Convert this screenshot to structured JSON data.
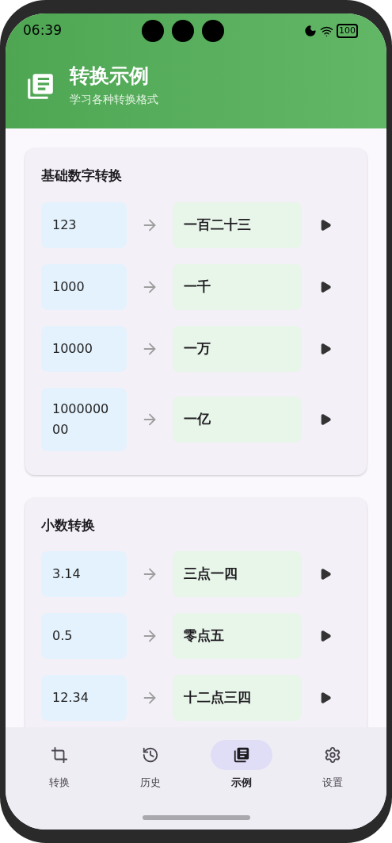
{
  "status_bar": {
    "time": "06:39",
    "battery": "100"
  },
  "header": {
    "title": "转换示例",
    "subtitle": "学习各种转换格式"
  },
  "sections": [
    {
      "title": "基础数字转换",
      "examples": [
        {
          "input": "123",
          "output": "一百二十三"
        },
        {
          "input": "1000",
          "output": "一千"
        },
        {
          "input": "10000",
          "output": "一万"
        },
        {
          "input": "100000000",
          "output": "一亿"
        }
      ]
    },
    {
      "title": "小数转换",
      "examples": [
        {
          "input": "3.14",
          "output": "三点一四"
        },
        {
          "input": "0.5",
          "output": "零点五"
        },
        {
          "input": "12.34",
          "output": "十二点三四"
        }
      ]
    }
  ],
  "nav": [
    {
      "label": "转换",
      "selected": false
    },
    {
      "label": "历史",
      "selected": false
    },
    {
      "label": "示例",
      "selected": true
    },
    {
      "label": "设置",
      "selected": false
    }
  ]
}
